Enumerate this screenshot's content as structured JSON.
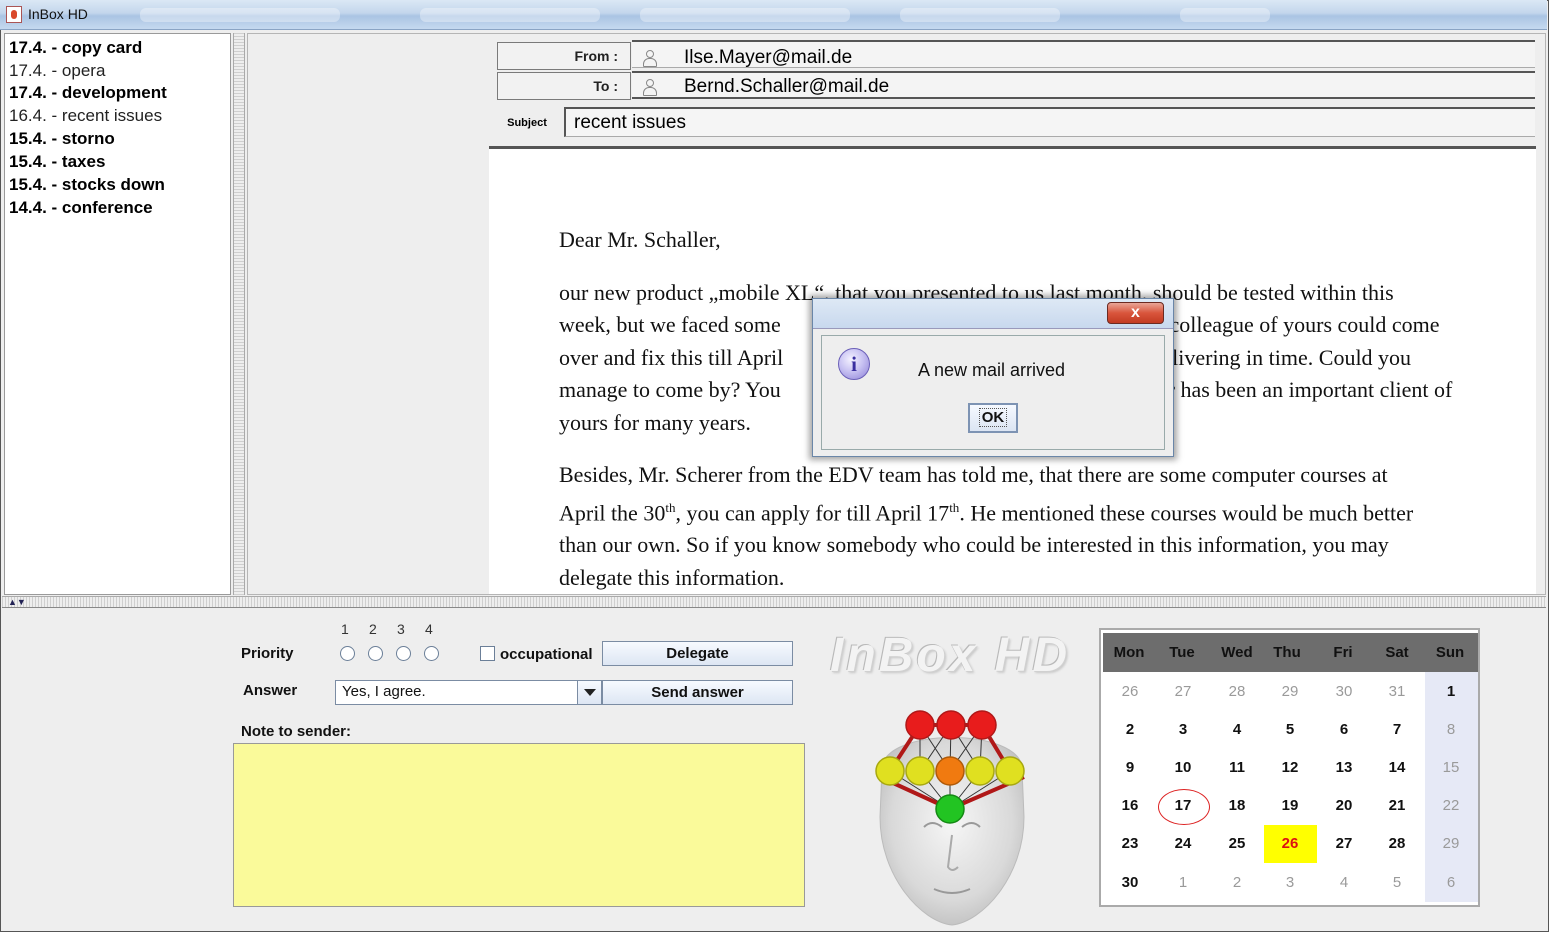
{
  "window": {
    "title": "InBox HD"
  },
  "mail_list": [
    {
      "date": "17.4.",
      "subject": "copy card",
      "read": false
    },
    {
      "date": "17.4.",
      "subject": "opera",
      "read": true
    },
    {
      "date": "17.4.",
      "subject": "development",
      "read": false
    },
    {
      "date": "16.4.",
      "subject": "recent issues",
      "read": true
    },
    {
      "date": "15.4.",
      "subject": "storno",
      "read": false
    },
    {
      "date": "15.4.",
      "subject": "taxes",
      "read": false
    },
    {
      "date": "15.4.",
      "subject": "stocks down",
      "read": false
    },
    {
      "date": "14.4.",
      "subject": "conference",
      "read": false
    }
  ],
  "mail": {
    "from_label": "From :",
    "from_value": "Ilse.Mayer@mail.de",
    "to_label": "To :",
    "to_value": "Bernd.Schaller@mail.de",
    "subject_label": "Subject",
    "subject_value": "recent issues",
    "greeting": "Dear Mr. Schaller,",
    "para1_a": "our new product „mobile XL“, that you presented to us last month, should be tested within this",
    "para1_b": "week, but we faced some",
    "para1_b2": "a colleague of yours could come",
    "para1_c": "over and fix this till April",
    "para1_c2": "time delivering in time. Could you",
    "para1_d": "manage to come by? You",
    "para1_d2": "for has been an important client of",
    "para1_e": "yours for many years.",
    "para2_a": "Besides, Mr. Scherer from the EDV team has told me, that there are some computer courses at",
    "para2_b1": "April the 30",
    "para2_b_sup1": "th",
    "para2_b2": ", you can apply for till April 17",
    "para2_b_sup2": "th",
    "para2_b3": ". He mentioned these courses would be much better",
    "para2_c": "than our own. So if you know somebody who could be interested in this information, you may",
    "para2_d": "delegate this information."
  },
  "controls": {
    "priority_label": "Priority",
    "priority_numbers": [
      "1",
      "2",
      "3",
      "4"
    ],
    "occupational_label": "occupational",
    "delegate_label": "Delegate",
    "answer_label": "Answer",
    "answer_value": "Yes, I agree.",
    "send_label": "Send answer",
    "note_label": "Note to sender:"
  },
  "logo": "InBox HD",
  "calendar": {
    "headers": [
      "Mon",
      "Tue",
      "Wed",
      "Thu",
      "Fri",
      "Sat",
      "Sun"
    ],
    "weeks": [
      [
        "26",
        "27",
        "28",
        "29",
        "30",
        "31",
        "1"
      ],
      [
        "2",
        "3",
        "4",
        "5",
        "6",
        "7",
        "8"
      ],
      [
        "9",
        "10",
        "11",
        "12",
        "13",
        "14",
        "15"
      ],
      [
        "16",
        "17",
        "18",
        "19",
        "20",
        "21",
        "22"
      ],
      [
        "23",
        "24",
        "25",
        "26",
        "27",
        "28",
        "29"
      ],
      [
        "30",
        "1",
        "2",
        "3",
        "4",
        "5",
        "6"
      ]
    ],
    "today": "17",
    "highlighted": "26",
    "highlight_color": "#ffff00",
    "today_ring_color": "#dd2222"
  },
  "dialog": {
    "close_label": "x",
    "message": "A new mail arrived",
    "ok_label": "OK",
    "icon": "info-icon"
  },
  "head_colors": {
    "top": "#e81c1c",
    "middle": "#e0e020",
    "center": "#f07a10",
    "bottom": "#22c422"
  }
}
